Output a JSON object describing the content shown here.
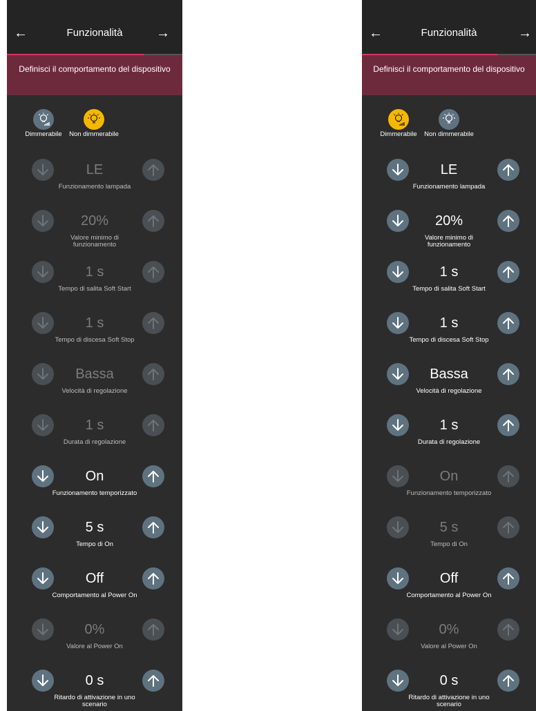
{
  "screens": [
    {
      "header": {
        "back_icon": "arrow-left-icon",
        "title": "Funzionalità",
        "forward_icon": "arrow-right-icon",
        "progress": 0.78
      },
      "banner": "Definisci il comportamento del dispositivo",
      "types": [
        {
          "label": "Dimmerabile",
          "selected": false,
          "icon": "dimmable-bulb-icon"
        },
        {
          "label": "Non dimmerabile",
          "selected": true,
          "icon": "bulb-icon"
        }
      ],
      "rows": [
        {
          "value": "LE",
          "caption": "Funzionamento lampada",
          "enabled": false
        },
        {
          "value": "20%",
          "caption": "Valore minimo di funzionamento",
          "enabled": false
        },
        {
          "value": "1 s",
          "caption": "Tempo di salita Soft Start",
          "enabled": false
        },
        {
          "value": "1 s",
          "caption": "Tempo di discesa Soft Stop",
          "enabled": false
        },
        {
          "value": "Bassa",
          "caption": "Velocità di regolazione",
          "enabled": false
        },
        {
          "value": "1 s",
          "caption": "Durata di regolazione",
          "enabled": false
        },
        {
          "value": "On",
          "caption": "Funzionamento temporizzato",
          "enabled": true
        },
        {
          "value": "5 s",
          "caption": "Tempo di On",
          "enabled": true
        },
        {
          "value": "Off",
          "caption": "Comportamento al Power On",
          "enabled": true
        },
        {
          "value": "0%",
          "caption": "Valore al Power On",
          "enabled": false
        },
        {
          "value": "0 s",
          "caption": "Ritardo di attivazione in uno scenario",
          "enabled": true
        }
      ]
    },
    {
      "header": {
        "back_icon": "arrow-left-icon",
        "title": "Funzionalità",
        "forward_icon": "arrow-right-icon",
        "progress": 0.78
      },
      "banner": "Definisci il comportamento del dispositivo",
      "types": [
        {
          "label": "Dimmerabile",
          "selected": true,
          "icon": "dimmable-bulb-icon"
        },
        {
          "label": "Non dimmerabile",
          "selected": false,
          "icon": "bulb-icon"
        }
      ],
      "rows": [
        {
          "value": "LE",
          "caption": "Funzionamento lampada",
          "enabled": true
        },
        {
          "value": "20%",
          "caption": "Valore minimo di funzionamento",
          "enabled": true
        },
        {
          "value": "1 s",
          "caption": "Tempo di salita Soft Start",
          "enabled": true
        },
        {
          "value": "1 s",
          "caption": "Tempo di discesa Soft Stop",
          "enabled": true
        },
        {
          "value": "Bassa",
          "caption": "Velocità di regolazione",
          "enabled": true
        },
        {
          "value": "1 s",
          "caption": "Durata di regolazione",
          "enabled": true
        },
        {
          "value": "On",
          "caption": "Funzionamento temporizzato",
          "enabled": false
        },
        {
          "value": "5 s",
          "caption": "Tempo di On",
          "enabled": false
        },
        {
          "value": "Off",
          "caption": "Comportamento al Power On",
          "enabled": true
        },
        {
          "value": "0%",
          "caption": "Valore al Power On",
          "enabled": false
        },
        {
          "value": "0 s",
          "caption": "Ritardo di attivazione in uno scenario",
          "enabled": true
        }
      ]
    }
  ]
}
